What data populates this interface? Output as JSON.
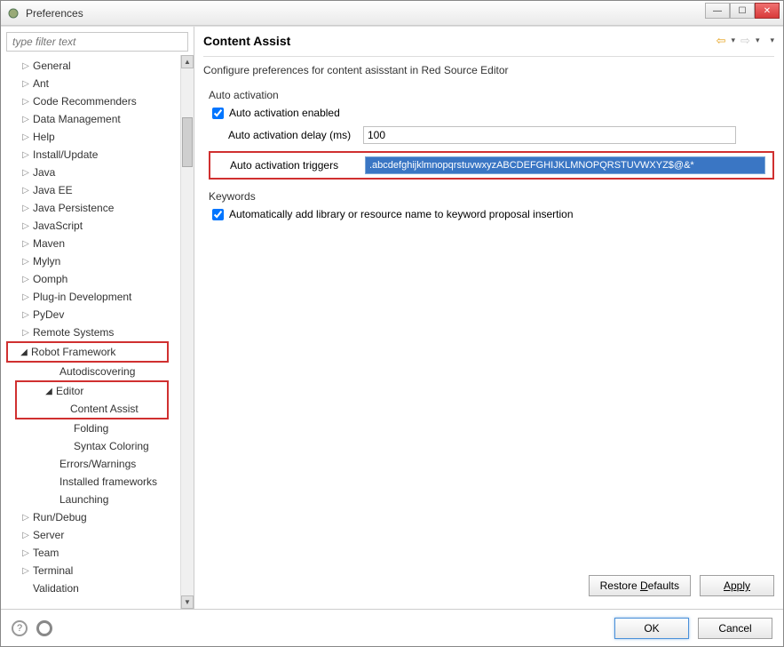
{
  "window": {
    "title": "Preferences"
  },
  "filter": {
    "placeholder": "type filter text"
  },
  "tree": {
    "items": [
      {
        "label": "General",
        "expand": "▷"
      },
      {
        "label": "Ant",
        "expand": "▷"
      },
      {
        "label": "Code Recommenders",
        "expand": "▷"
      },
      {
        "label": "Data Management",
        "expand": "▷"
      },
      {
        "label": "Help",
        "expand": "▷"
      },
      {
        "label": "Install/Update",
        "expand": "▷"
      },
      {
        "label": "Java",
        "expand": "▷"
      },
      {
        "label": "Java EE",
        "expand": "▷"
      },
      {
        "label": "Java Persistence",
        "expand": "▷"
      },
      {
        "label": "JavaScript",
        "expand": "▷"
      },
      {
        "label": "Maven",
        "expand": "▷"
      },
      {
        "label": "Mylyn",
        "expand": "▷"
      },
      {
        "label": "Oomph",
        "expand": "▷"
      },
      {
        "label": "Plug-in Development",
        "expand": "▷"
      },
      {
        "label": "PyDev",
        "expand": "▷"
      },
      {
        "label": "Remote Systems",
        "expand": "▷"
      },
      {
        "label": "Robot Framework",
        "expand": "◢"
      },
      {
        "label": "Autodiscovering",
        "expand": ""
      },
      {
        "label": "Editor",
        "expand": "◢"
      },
      {
        "label": "Content Assist",
        "expand": ""
      },
      {
        "label": "Folding",
        "expand": ""
      },
      {
        "label": "Syntax Coloring",
        "expand": ""
      },
      {
        "label": "Errors/Warnings",
        "expand": ""
      },
      {
        "label": "Installed frameworks",
        "expand": ""
      },
      {
        "label": "Launching",
        "expand": ""
      },
      {
        "label": "Run/Debug",
        "expand": "▷"
      },
      {
        "label": "Server",
        "expand": "▷"
      },
      {
        "label": "Team",
        "expand": "▷"
      },
      {
        "label": "Terminal",
        "expand": "▷"
      },
      {
        "label": "Validation",
        "expand": ""
      }
    ]
  },
  "page": {
    "title": "Content Assist",
    "description": "Configure preferences for content asisstant in Red Source Editor",
    "auto_activation_group": "Auto activation",
    "auto_activation_enabled_label": "Auto activation enabled",
    "auto_activation_enabled": true,
    "delay_label": "Auto activation delay (ms)",
    "delay_value": "100",
    "triggers_label": "Auto activation triggers",
    "triggers_value": ".abcdefghijklmnopqrstuvwxyzABCDEFGHIJKLMNOPQRSTUVWXYZ$@&*",
    "keywords_group": "Keywords",
    "keywords_auto_label": "Automatically add library or resource name to keyword proposal insertion",
    "keywords_auto": true
  },
  "buttons": {
    "restore_defaults": "Restore Defaults",
    "apply": "Apply",
    "ok": "OK",
    "cancel": "Cancel"
  }
}
